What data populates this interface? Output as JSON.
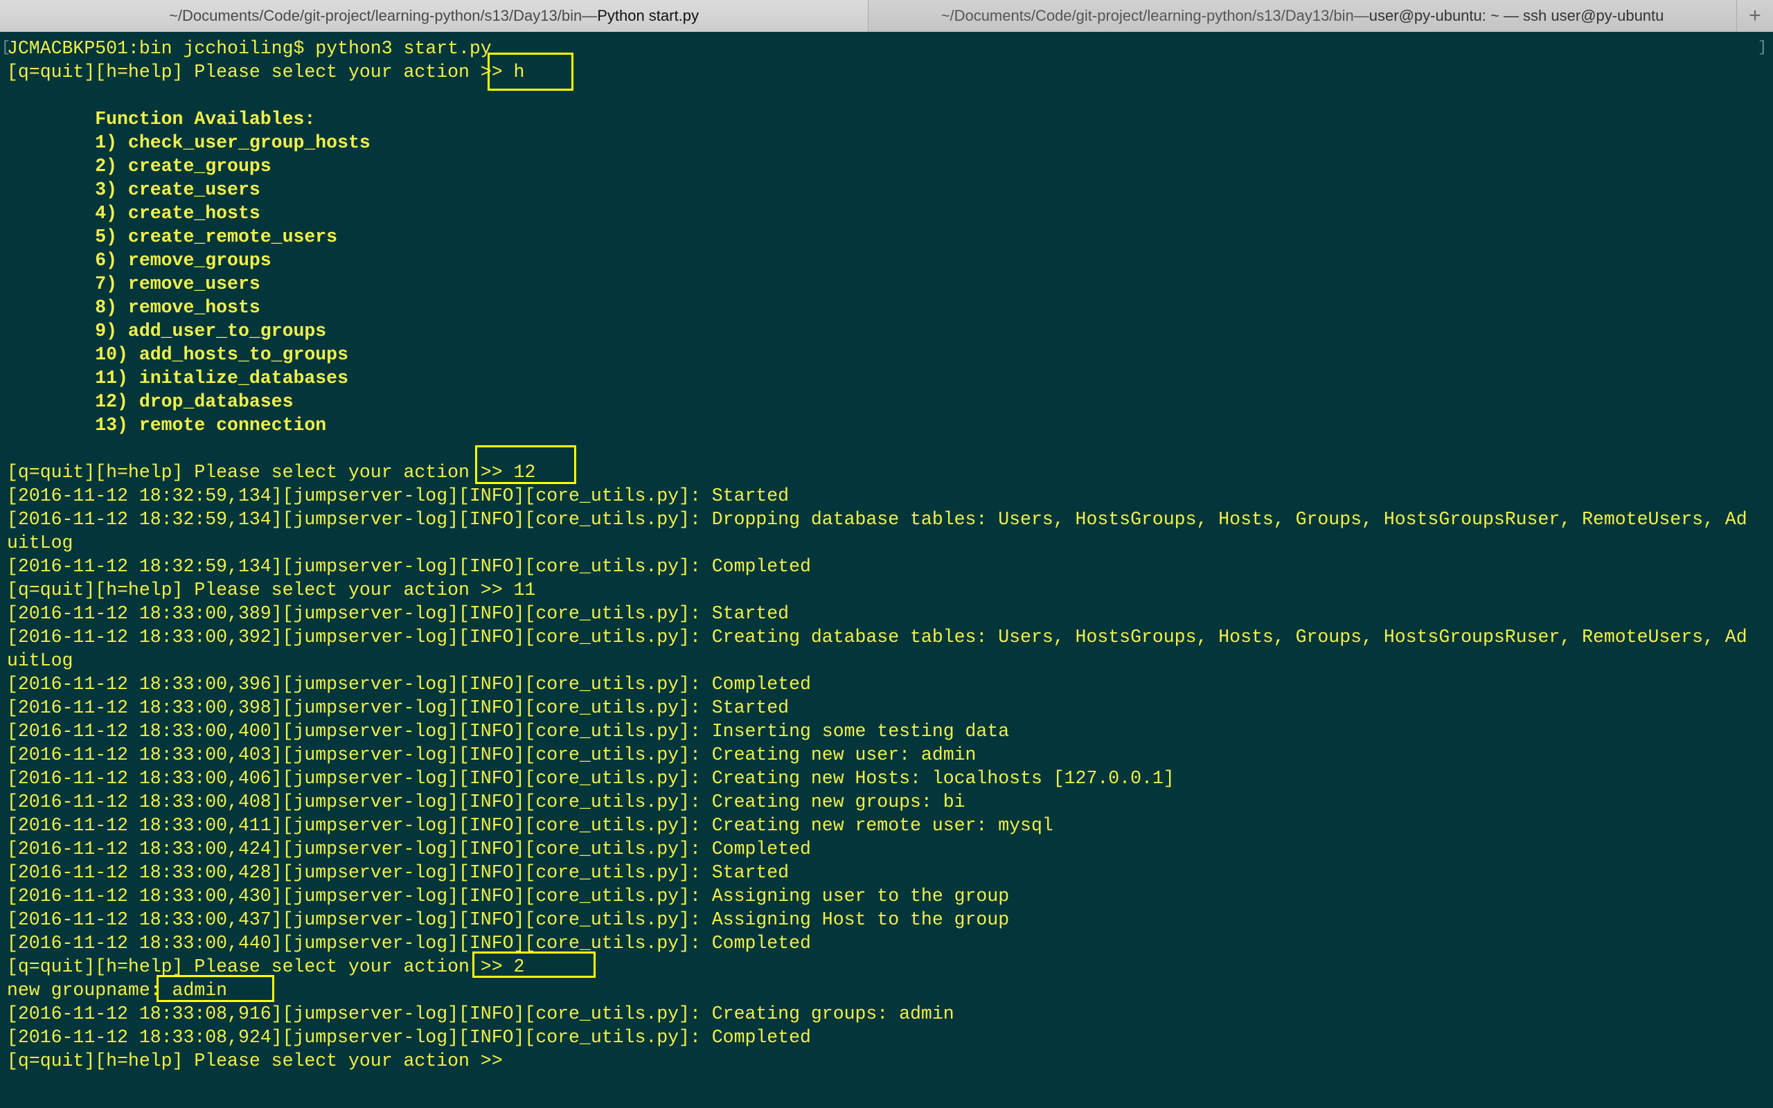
{
  "tabs": [
    {
      "path": "~/Documents/Code/git-project/learning-python/s13/Day13/bin",
      "sep": " — ",
      "process": "Python start.py",
      "active": true
    },
    {
      "path": "~/Documents/Code/git-project/learning-python/s13/Day13/bin",
      "sep": " — ",
      "process": "user@py-ubuntu: ~ — ssh user@py-ubuntu",
      "active": false
    }
  ],
  "new_tab_label": "+",
  "terminal": {
    "lines": [
      {
        "text": "JCMACBKP501:bin jcchoiling$ python3 start.py",
        "bold": false
      },
      {
        "text": "[q=quit][h=help] Please select your action >> h",
        "bold": false
      },
      {
        "text": "",
        "bold": false
      },
      {
        "text": "        Function Availables:",
        "bold": true
      },
      {
        "text": "        1) check_user_group_hosts",
        "bold": true
      },
      {
        "text": "        2) create_groups",
        "bold": true
      },
      {
        "text": "        3) create_users",
        "bold": true
      },
      {
        "text": "        4) create_hosts",
        "bold": true
      },
      {
        "text": "        5) create_remote_users",
        "bold": true
      },
      {
        "text": "        6) remove_groups",
        "bold": true
      },
      {
        "text": "        7) remove_users",
        "bold": true
      },
      {
        "text": "        8) remove_hosts",
        "bold": true
      },
      {
        "text": "        9) add_user_to_groups",
        "bold": true
      },
      {
        "text": "        10) add_hosts_to_groups",
        "bold": true
      },
      {
        "text": "        11) initalize_databases",
        "bold": true
      },
      {
        "text": "        12) drop_databases",
        "bold": true
      },
      {
        "text": "        13) remote connection",
        "bold": true
      },
      {
        "text": "",
        "bold": false
      },
      {
        "text": "[q=quit][h=help] Please select your action >> 12",
        "bold": false
      },
      {
        "text": "[2016-11-12 18:32:59,134][jumpserver-log][INFO][core_utils.py]: Started",
        "bold": false
      },
      {
        "text": "[2016-11-12 18:32:59,134][jumpserver-log][INFO][core_utils.py]: Dropping database tables: Users, HostsGroups, Hosts, Groups, HostsGroupsRuser, RemoteUsers, Ad",
        "bold": false
      },
      {
        "text": "uitLog",
        "bold": false
      },
      {
        "text": "[2016-11-12 18:32:59,134][jumpserver-log][INFO][core_utils.py]: Completed",
        "bold": false
      },
      {
        "text": "[q=quit][h=help] Please select your action >> 11",
        "bold": false
      },
      {
        "text": "[2016-11-12 18:33:00,389][jumpserver-log][INFO][core_utils.py]: Started",
        "bold": false
      },
      {
        "text": "[2016-11-12 18:33:00,392][jumpserver-log][INFO][core_utils.py]: Creating database tables: Users, HostsGroups, Hosts, Groups, HostsGroupsRuser, RemoteUsers, Ad",
        "bold": false
      },
      {
        "text": "uitLog",
        "bold": false
      },
      {
        "text": "[2016-11-12 18:33:00,396][jumpserver-log][INFO][core_utils.py]: Completed",
        "bold": false
      },
      {
        "text": "[2016-11-12 18:33:00,398][jumpserver-log][INFO][core_utils.py]: Started",
        "bold": false
      },
      {
        "text": "[2016-11-12 18:33:00,400][jumpserver-log][INFO][core_utils.py]: Inserting some testing data",
        "bold": false
      },
      {
        "text": "[2016-11-12 18:33:00,403][jumpserver-log][INFO][core_utils.py]: Creating new user: admin",
        "bold": false
      },
      {
        "text": "[2016-11-12 18:33:00,406][jumpserver-log][INFO][core_utils.py]: Creating new Hosts: localhosts [127.0.0.1]",
        "bold": false
      },
      {
        "text": "[2016-11-12 18:33:00,408][jumpserver-log][INFO][core_utils.py]: Creating new groups: bi",
        "bold": false
      },
      {
        "text": "[2016-11-12 18:33:00,411][jumpserver-log][INFO][core_utils.py]: Creating new remote user: mysql",
        "bold": false
      },
      {
        "text": "[2016-11-12 18:33:00,424][jumpserver-log][INFO][core_utils.py]: Completed",
        "bold": false
      },
      {
        "text": "[2016-11-12 18:33:00,428][jumpserver-log][INFO][core_utils.py]: Started",
        "bold": false
      },
      {
        "text": "[2016-11-12 18:33:00,430][jumpserver-log][INFO][core_utils.py]: Assigning user to the group",
        "bold": false
      },
      {
        "text": "[2016-11-12 18:33:00,437][jumpserver-log][INFO][core_utils.py]: Assigning Host to the group",
        "bold": false
      },
      {
        "text": "[2016-11-12 18:33:00,440][jumpserver-log][INFO][core_utils.py]: Completed",
        "bold": false
      },
      {
        "text": "[q=quit][h=help] Please select your action >> 2",
        "bold": false
      },
      {
        "text": "new groupname: admin",
        "bold": false
      },
      {
        "text": "[2016-11-12 18:33:08,916][jumpserver-log][INFO][core_utils.py]: Creating groups: admin",
        "bold": false
      },
      {
        "text": "[2016-11-12 18:33:08,924][jumpserver-log][INFO][core_utils.py]: Completed",
        "bold": false
      },
      {
        "text": "[q=quit][h=help] Please select your action >>",
        "bold": false
      }
    ]
  },
  "colors": {
    "background": "#02363a",
    "text": "#f2f04a",
    "highlight_box": "#ffff00"
  }
}
